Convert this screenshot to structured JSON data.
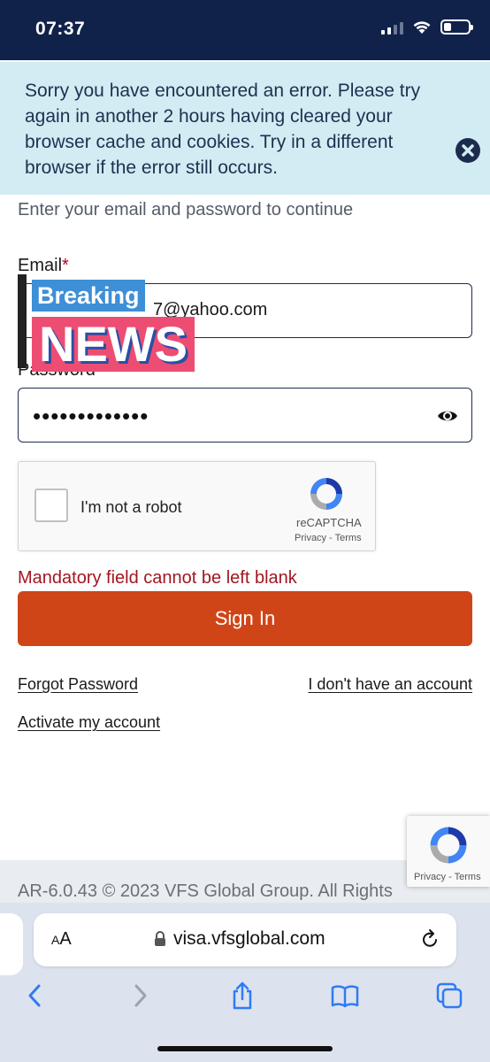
{
  "status_bar": {
    "time": "07:37"
  },
  "error_banner": {
    "message": "Sorry you have encountered an error. Please try again in another 2 hours having cleared your browser cache and cookies. Try in a different browser if the error still occurs.",
    "close_icon": "close-circle-icon"
  },
  "login": {
    "subtitle": "Enter your email and password to continue",
    "email_label": "Email",
    "required_marker": "*",
    "email_value": "7@yahoo.com",
    "password_label": "Password",
    "password_value": "•••••••••••••",
    "captcha_label": "I'm not a robot",
    "captcha_brand": "reCAPTCHA",
    "captcha_links": "Privacy - Terms",
    "error_message": "Mandatory field cannot be left blank",
    "signin_label": "Sign In",
    "forgot_password": "Forgot Password",
    "no_account": "I don't have an account",
    "activate_account": "Activate my account"
  },
  "overlay": {
    "line1": "Breaking",
    "line2": "NEWS"
  },
  "recaptcha_badge": {
    "links": "Privacy - Terms"
  },
  "footer": {
    "text": "AR-6.0.43 © 2023 VFS Global Group. All Rights"
  },
  "browser": {
    "aa_label": "AA",
    "url": "visa.vfsglobal.com",
    "icons": [
      "back-icon",
      "forward-icon",
      "share-icon",
      "bookmarks-icon",
      "tabs-icon"
    ]
  },
  "colors": {
    "status_bar": "#11224a",
    "banner": "#d2ecf3",
    "signin_button": "#d04518",
    "error_text": "#a31621",
    "ios_blue": "#2f7bf6"
  }
}
